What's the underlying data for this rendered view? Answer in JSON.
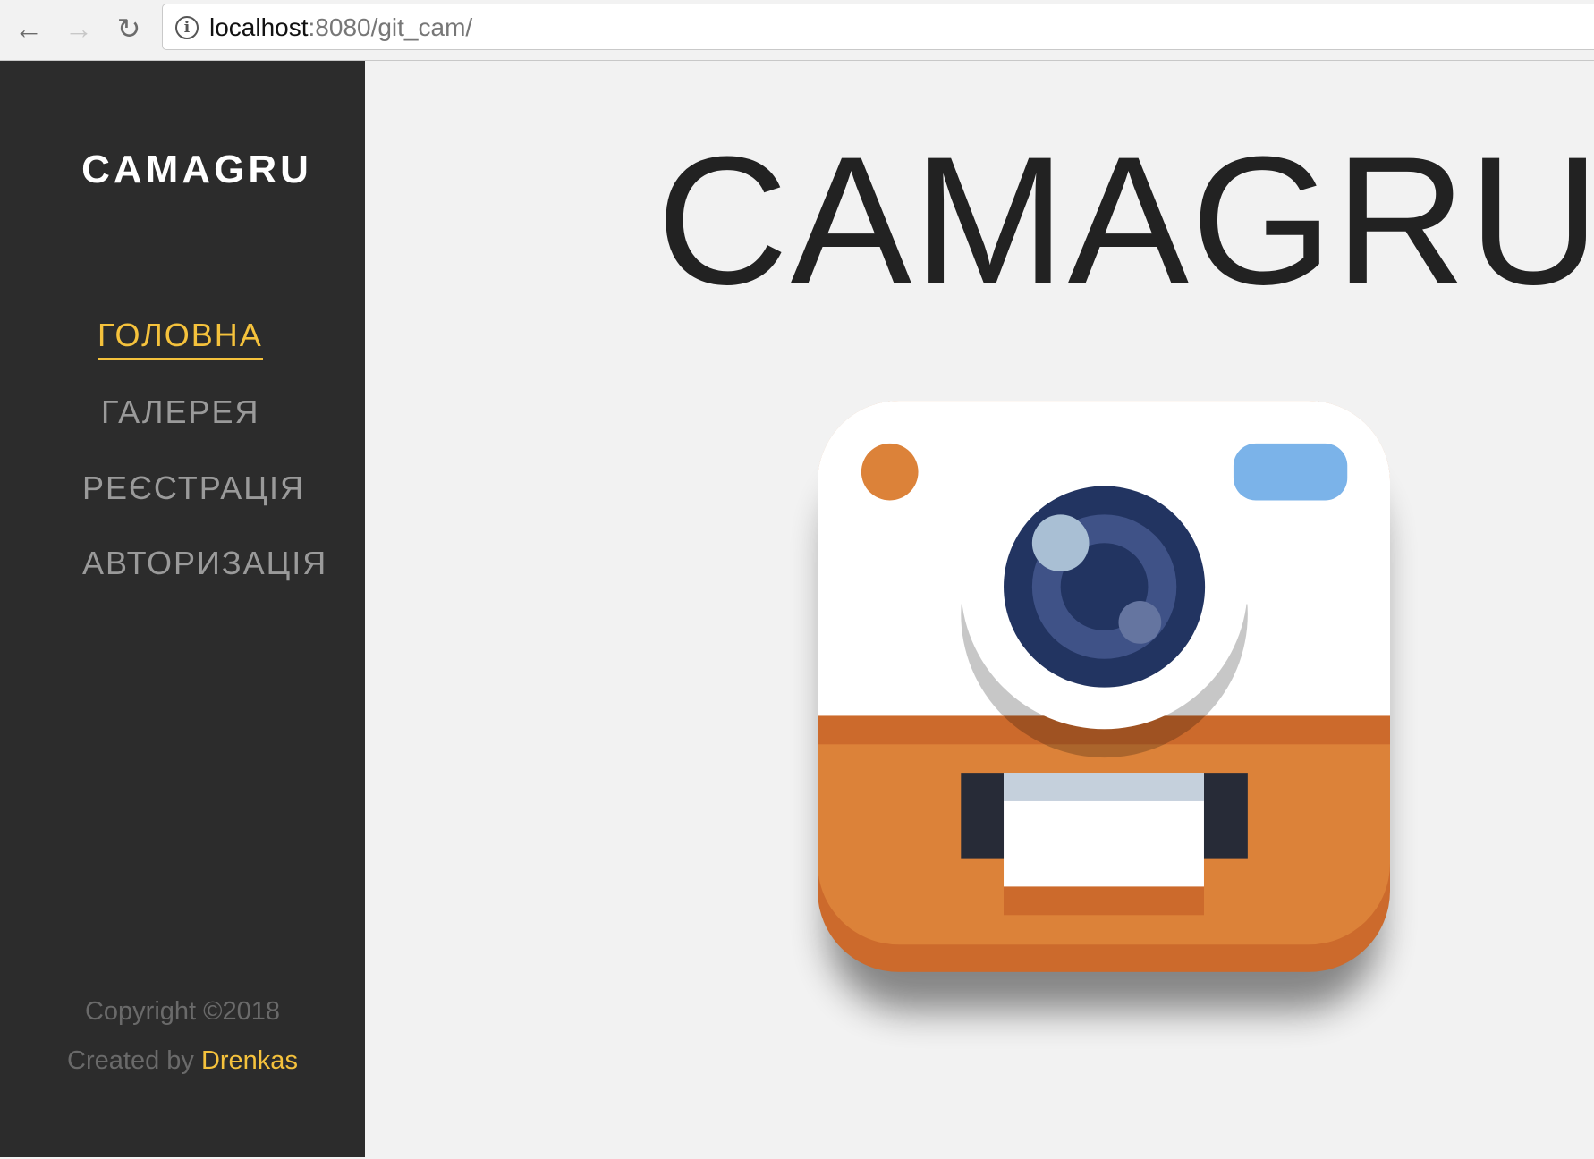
{
  "browser": {
    "url_host": "localhost",
    "url_rest": ":8080/git_cam/",
    "back_icon": "arrow-left-icon",
    "forward_icon": "arrow-right-icon",
    "reload_icon": "reload-icon",
    "info_icon": "info-icon",
    "info_glyph": "i"
  },
  "sidebar": {
    "logo": "CAMAGRU",
    "items": [
      {
        "label": "ГОЛОВНА",
        "active": true
      },
      {
        "label": "ГАЛЕРЕЯ",
        "active": false
      },
      {
        "label": "РЕЄСТРАЦІЯ",
        "active": false
      },
      {
        "label": "АВТОРИЗАЦІЯ",
        "active": false
      }
    ],
    "footer": {
      "copyright": "Copyright ©2018",
      "created_by": "Created by",
      "author": "Drenkas"
    }
  },
  "main": {
    "title": "CAMAGRU",
    "image_icon": "camera-icon"
  },
  "colors": {
    "sidebar_bg": "#2c2c2c",
    "accent": "#f5c23c",
    "camera_orange": "#dc8239",
    "camera_lens": "#223461"
  }
}
